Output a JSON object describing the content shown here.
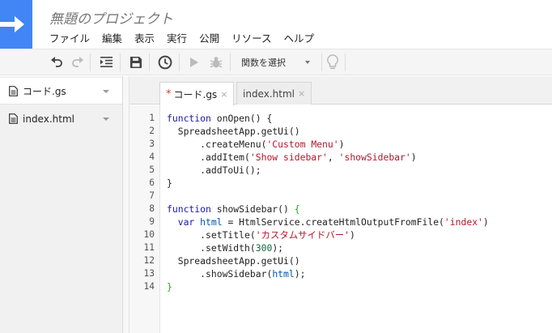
{
  "project": {
    "title": "無題のプロジェクト"
  },
  "menu": [
    "ファイル",
    "編集",
    "表示",
    "実行",
    "公開",
    "リソース",
    "ヘルプ"
  ],
  "toolbar": {
    "icons": [
      "undo-icon",
      "redo-icon",
      "indent-icon",
      "save-icon",
      "trigger-clock-icon",
      "run-icon",
      "debug-bug-icon",
      "lightbulb-icon"
    ],
    "function_select": "関数を選択"
  },
  "files": [
    {
      "name": "コード.gs"
    },
    {
      "name": "index.html"
    }
  ],
  "tabs": [
    {
      "name": "コード.gs",
      "modified_marker": "*",
      "close": "×"
    },
    {
      "name": "index.html",
      "close": "×"
    }
  ],
  "colors": {
    "logo_blue": "#4285f4",
    "keyword": "#1a1aa6",
    "string": "#b5162b",
    "number": "#116644",
    "variable": "#0055aa",
    "bracket_match": "#22aa22",
    "modified_star": "#d23f31"
  },
  "editor": {
    "line_numbers": [
      "1",
      "2",
      "3",
      "4",
      "5",
      "6",
      "7",
      "8",
      "9",
      "10",
      "11",
      "12",
      "13",
      "14"
    ],
    "code": {
      "l1": {
        "kw": "function",
        "rest": " onOpen() {"
      },
      "l2": {
        "text": "  SpreadsheetApp.getUi()"
      },
      "l3": {
        "pre": "      .createMenu(",
        "str": "'Custom Menu'",
        "post": ")"
      },
      "l4": {
        "pre": "      .addItem(",
        "str1": "'Show sidebar'",
        "mid": ", ",
        "str2": "'showSidebar'",
        "post": ")"
      },
      "l5": {
        "text": "      .addToUi();"
      },
      "l6": {
        "text": "}"
      },
      "l7": {
        "text": ""
      },
      "l8": {
        "kw": "function",
        "rest": " showSidebar() ",
        "brace": "{"
      },
      "l9": {
        "kw": "  var",
        "sp": " ",
        "var": "html",
        "mid": " = HtmlService.createHtmlOutputFromFile(",
        "str": "'index'",
        "post": ")"
      },
      "l10": {
        "pre": "      .setTitle(",
        "str": "'カスタムサイドバー'",
        "post": ")"
      },
      "l11": {
        "pre": "      .setWidth(",
        "num": "300",
        "post": ");"
      },
      "l12": {
        "text": "  SpreadsheetApp.getUi()"
      },
      "l13": {
        "pre": "      .showSidebar(",
        "var": "html",
        "post": ");"
      },
      "l14": {
        "brace": "}"
      }
    }
  }
}
